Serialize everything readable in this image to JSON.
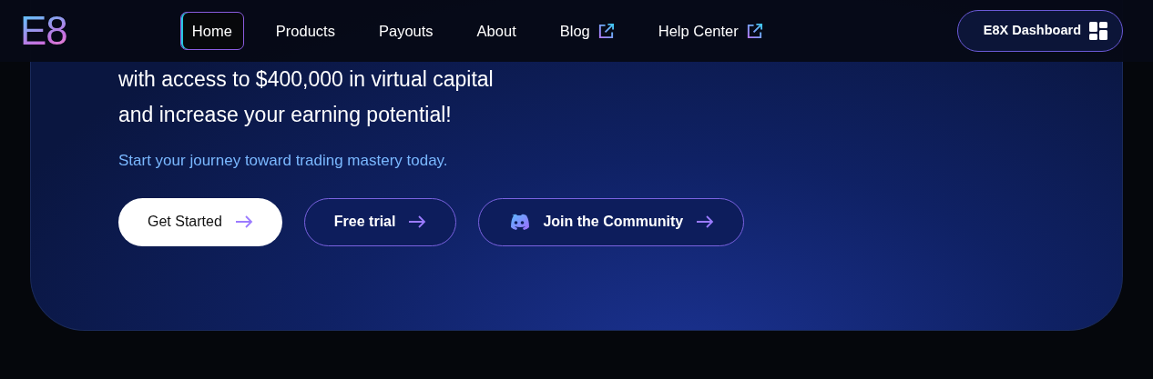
{
  "logo": "E8",
  "nav": [
    {
      "label": "Home",
      "selected": true,
      "external": false
    },
    {
      "label": "Products",
      "selected": false,
      "external": false
    },
    {
      "label": "Payouts",
      "selected": false,
      "external": false
    },
    {
      "label": "About",
      "selected": false,
      "external": false
    },
    {
      "label": "Blog",
      "selected": false,
      "external": true
    },
    {
      "label": "Help Center",
      "selected": false,
      "external": true
    }
  ],
  "dashboard_button": "E8X Dashboard",
  "hero": {
    "headline_lines": [
      "with access to $400,000 in virtual capital",
      "and increase your earning potential!"
    ],
    "subtitle": "Start your journey toward trading mastery today.",
    "buttons": [
      {
        "label": "Get Started",
        "kind": "solid"
      },
      {
        "label": "Free trial",
        "kind": "outline"
      },
      {
        "label": "Join the Community",
        "kind": "discord"
      }
    ]
  }
}
